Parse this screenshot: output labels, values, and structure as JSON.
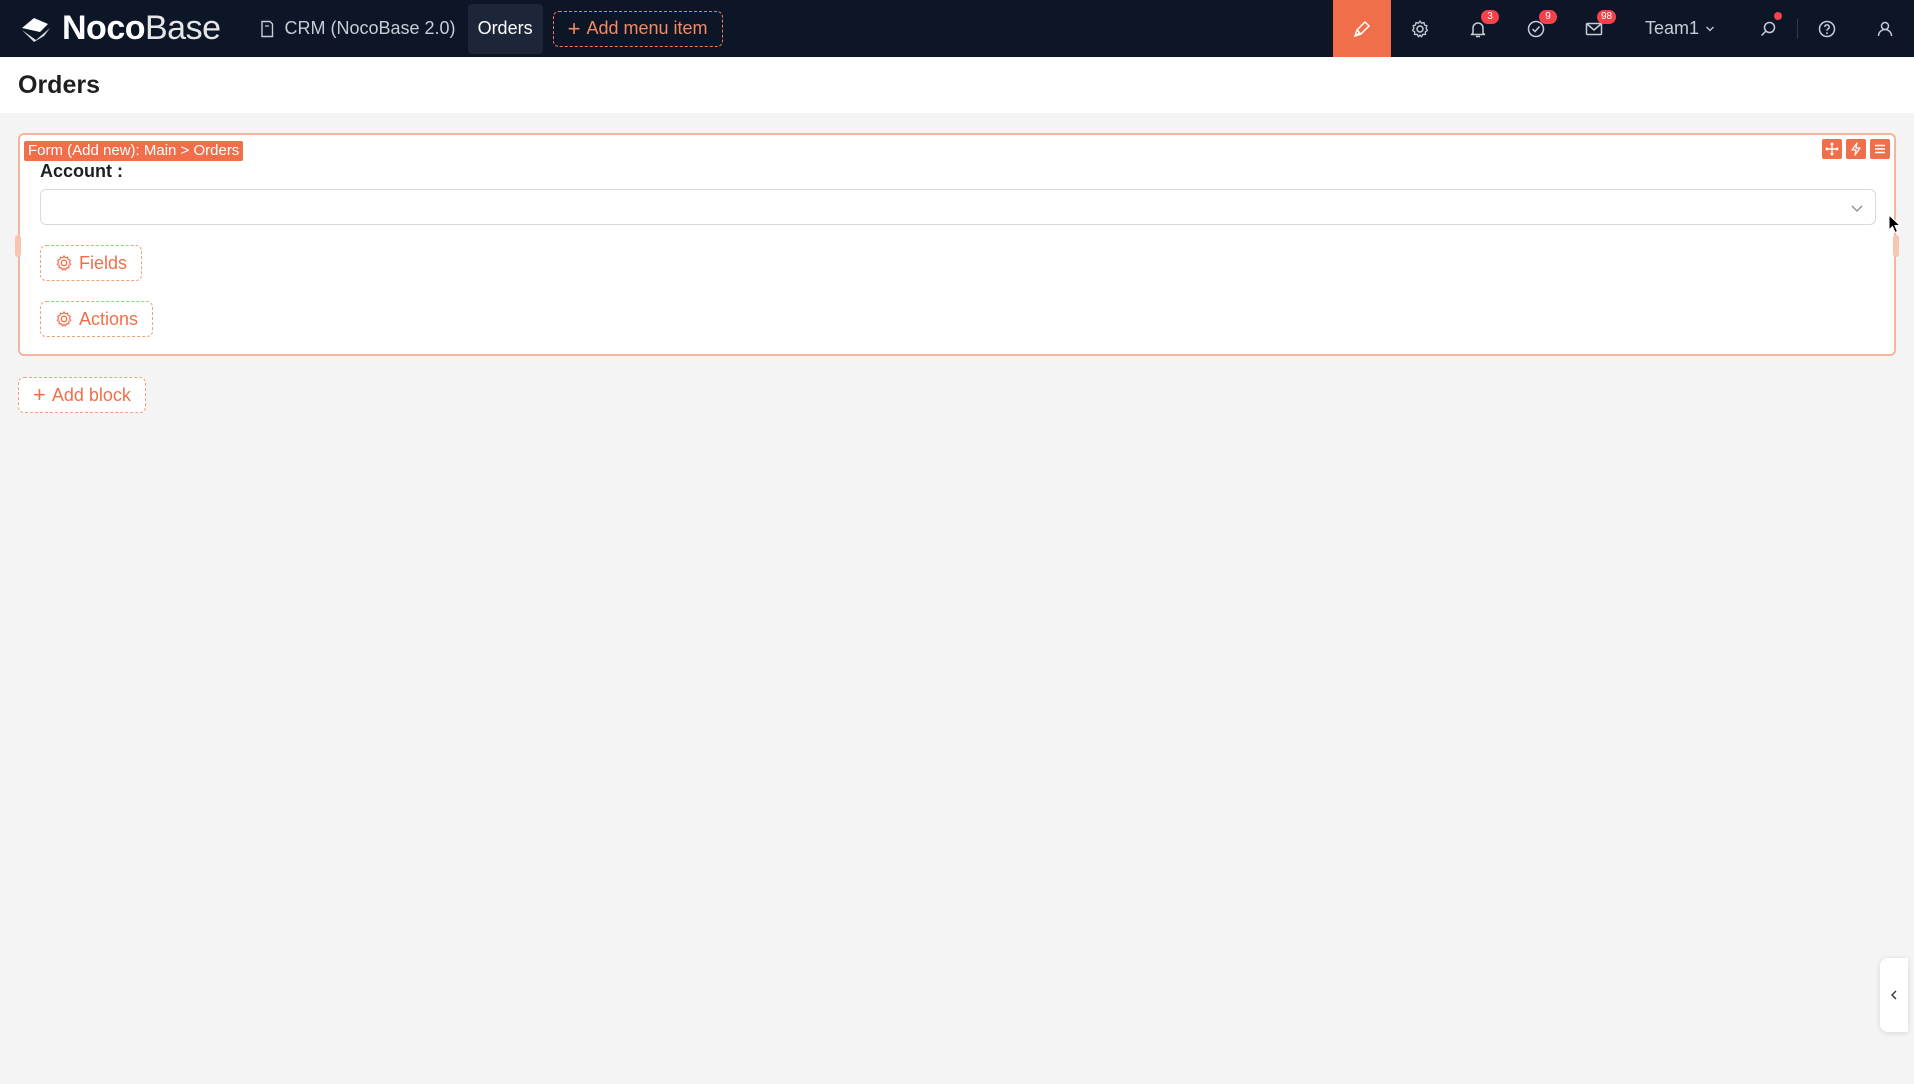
{
  "brand": {
    "name_bold": "Noco",
    "name_regular": "Base"
  },
  "nav": {
    "crm_label": "CRM (NocoBase 2.0)",
    "active_label": "Orders",
    "add_menu_label": "Add menu item"
  },
  "toolbar": {
    "notifications_badge": "3",
    "tasks_badge": "9",
    "messages_badge": "98",
    "team_label": "Team1"
  },
  "page": {
    "title": "Orders"
  },
  "form_block": {
    "tag": "Form (Add new): Main > Orders",
    "field_label": "Account :",
    "field_value": "",
    "fields_button": "Fields",
    "actions_button": "Actions"
  },
  "add_block_label": "Add block",
  "colors": {
    "topbar_bg": "#0d1626",
    "accent": "#f06f4a",
    "badge": "#f5424a"
  }
}
